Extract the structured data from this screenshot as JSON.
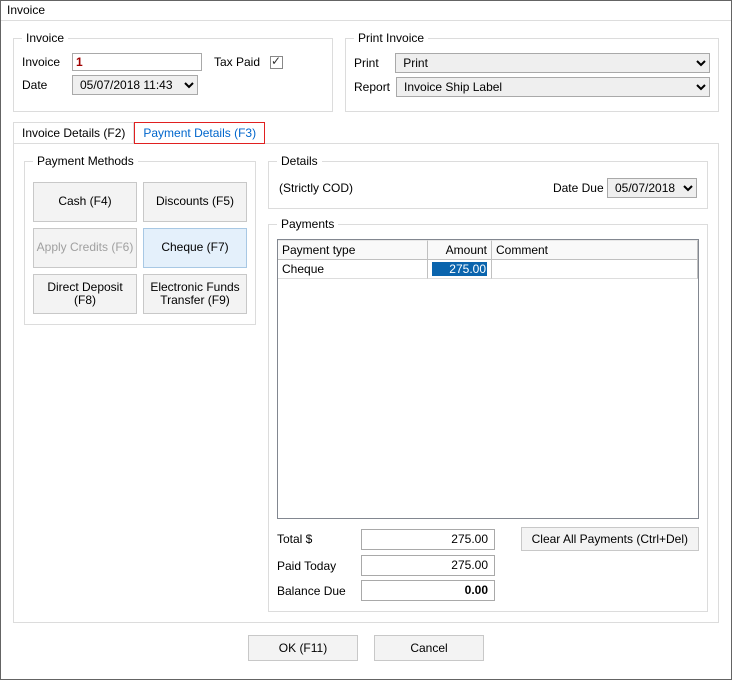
{
  "window": {
    "title": "Invoice"
  },
  "invoice_group": {
    "legend": "Invoice",
    "invoice_label": "Invoice",
    "invoice_value": "1",
    "taxpaid_label": "Tax Paid",
    "taxpaid_checked": true,
    "date_label": "Date",
    "date_value": "05/07/2018 11:43"
  },
  "print_group": {
    "legend": "Print Invoice",
    "print_label": "Print",
    "print_value": "Print",
    "report_label": "Report",
    "report_value": "Invoice Ship Label"
  },
  "tabs": {
    "invoice_details": "Invoice Details (F2)",
    "payment_details": "Payment Details (F3)"
  },
  "payment_methods": {
    "legend": "Payment Methods",
    "cash": "Cash (F4)",
    "discounts": "Discounts (F5)",
    "apply_credits": "Apply Credits (F6)",
    "cheque": "Cheque (F7)",
    "direct_deposit": "Direct Deposit (F8)",
    "eft": "Electronic Funds Transfer (F9)"
  },
  "details": {
    "legend": "Details",
    "cod": "(Strictly COD)",
    "date_due_label": "Date Due",
    "date_due_value": "05/07/2018"
  },
  "payments": {
    "legend": "Payments",
    "col_type": "Payment type",
    "col_amount": "Amount",
    "col_comment": "Comment",
    "rows": [
      {
        "type": "Cheque",
        "amount": "275.00",
        "comment": ""
      }
    ]
  },
  "totals": {
    "total_label": "Total $",
    "total_value": "275.00",
    "paid_label": "Paid Today",
    "paid_value": "275.00",
    "balance_label": "Balance Due",
    "balance_value": "0.00",
    "clear_label": "Clear All Payments (Ctrl+Del)"
  },
  "buttons": {
    "ok": "OK (F11)",
    "cancel": "Cancel"
  }
}
